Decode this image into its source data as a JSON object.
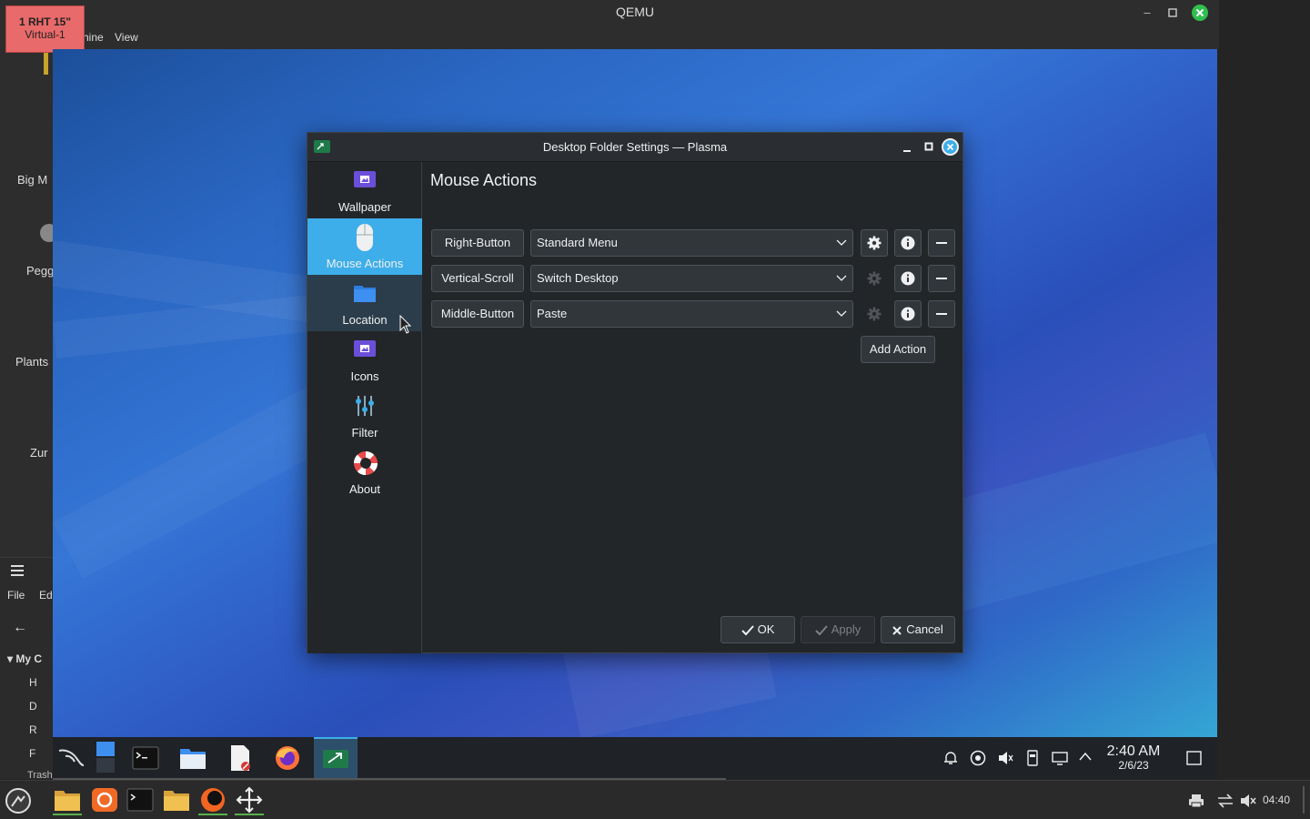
{
  "host": {
    "window_title": "QEMU",
    "badge_line1": "1 RHT 15\"",
    "badge_line2": "Virtual-1",
    "menu": [
      "hine",
      "View"
    ],
    "left_labels": [
      "Big M",
      "Pegg",
      "Plants",
      "Zur"
    ],
    "file_manager": {
      "menu_file": "File",
      "menu_edit": "Ed",
      "tree_header": "My C",
      "tree_items": [
        "H",
        "D",
        "R",
        "F"
      ],
      "trash": "Trash"
    },
    "clock": "04:40"
  },
  "dialog": {
    "title": "Desktop Folder Settings — Plasma",
    "sidebar": [
      {
        "label": "Wallpaper",
        "icon": "wallpaper-icon",
        "selected": false
      },
      {
        "label": "Mouse Actions",
        "icon": "mouse-icon",
        "selected": true
      },
      {
        "label": "Location",
        "icon": "folder-icon",
        "selected": false
      },
      {
        "label": "Icons",
        "icon": "icons-icon",
        "selected": false
      },
      {
        "label": "Filter",
        "icon": "filter-icon",
        "selected": false
      },
      {
        "label": "About",
        "icon": "lifebuoy-icon",
        "selected": false
      }
    ],
    "page_title": "Mouse Actions",
    "actions": [
      {
        "trigger": "Right-Button",
        "plugin": "Standard Menu",
        "configurable": true
      },
      {
        "trigger": "Vertical-Scroll",
        "plugin": "Switch Desktop",
        "configurable": false
      },
      {
        "trigger": "Middle-Button",
        "plugin": "Paste",
        "configurable": false
      }
    ],
    "add_action": "Add Action",
    "buttons": {
      "ok": "OK",
      "apply": "Apply",
      "cancel": "Cancel"
    }
  },
  "vm_panel": {
    "time": "2:40 AM",
    "date": "2/6/23"
  },
  "colors": {
    "accent": "#3daee9",
    "dialog_bg": "#232629",
    "button_bg": "#31363b"
  }
}
